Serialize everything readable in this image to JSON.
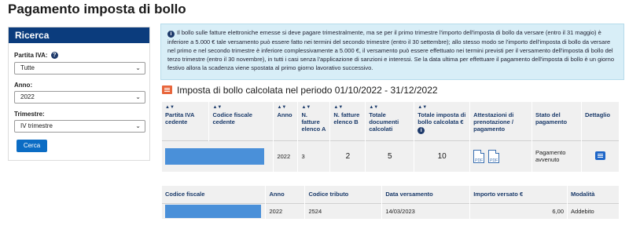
{
  "page": {
    "title": "Pagamento imposta di bollo"
  },
  "sidebar": {
    "header": "Ricerca",
    "partita_iva": {
      "label": "Partita IVA:",
      "value": "Tutte"
    },
    "anno": {
      "label": "Anno:",
      "value": "2022"
    },
    "trimestre": {
      "label": "Trimestre:",
      "value": "IV trimestre"
    },
    "search_button": "Cerca"
  },
  "info": {
    "text": "Il bollo sulle fatture elettroniche emesse si deve pagare trimestralmente, ma se per il primo trimestre l'importo dell'imposta di bollo da versare (entro il 31 maggio) è inferiore a 5.000 € tale versamento può essere fatto nei termini del secondo trimestre (entro il 30 settembre); allo stesso modo se l'importo dell'imposta di bollo da versare nel primo e nel secondo trimestre è inferiore complessivamente a 5.000 €, il versamento può essere effettuato nei termini previsti per il versamento dell'imposta di bollo del terzo trimestre (entro il 30 novembre), in tutti i casi senza l'applicazione di sanzioni e interessi. Se la data ultima per effettuare il pagamento dell'imposta di bollo è un giorno festivo allora la scadenza viene spostata al primo giorno lavorativo successivo."
  },
  "section": {
    "title": "Imposta di bollo calcolata nel periodo 01/10/2022 - 31/12/2022"
  },
  "calc_table": {
    "headers": {
      "partita_iva": "Partita IVA cedente",
      "codice_fiscale": "Codice fiscale cedente",
      "anno": "Anno",
      "fatture_a": "N. fatture elenco A",
      "fatture_b": "N. fatture elenco B",
      "totale_documenti": "Totale documenti calcolati",
      "totale_imposta": "Totale imposta di bollo calcolata €",
      "attestazioni": "Attestazioni di prenotazione / pagamento",
      "stato": "Stato del pagamento",
      "dettaglio": "Dettaglio"
    },
    "row": {
      "anno": "2022",
      "fatture_a": "3",
      "fatture_b": "2",
      "totale_documenti": "5",
      "totale_imposta": "10",
      "stato": "Pagamento avvenuto"
    }
  },
  "pay_table": {
    "headers": {
      "codice_fiscale": "Codice fiscale",
      "anno": "Anno",
      "codice_tributo": "Codice tributo",
      "data_versamento": "Data versamento",
      "importo": "Importo versato €",
      "modalita": "Modalità"
    },
    "row": {
      "anno": "2022",
      "codice_tributo": "2524",
      "data_versamento": "14/03/2023",
      "importo": "6,00",
      "modalita": "Addebito"
    }
  },
  "icons": {
    "help": "help-icon",
    "info": "info-icon",
    "chevron": "chevron-down-icon",
    "sort": "sort-icon",
    "pdf": "pdf-icon",
    "detail": "detail-icon",
    "section": "list-icon"
  },
  "colors": {
    "header_blue": "#0b3c7d",
    "button_blue": "#0b6cc4",
    "info_bg": "#d8eef7",
    "section_orange": "#e8663c",
    "redacted": "#4a90d9"
  }
}
